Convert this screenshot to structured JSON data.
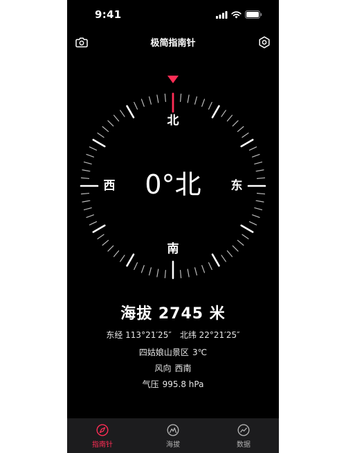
{
  "status_bar": {
    "time": "9:41"
  },
  "header": {
    "title": "极简指南针",
    "left_icon": "camera-icon",
    "right_icon": "settings-hexagon-icon"
  },
  "compass": {
    "heading_degrees": 0,
    "heading_text": "0°北",
    "directions": {
      "north": "北",
      "east": "东",
      "south": "南",
      "west": "西"
    },
    "needle_color": "#ff2d55"
  },
  "info": {
    "altitude_label": "海拔 2745 米",
    "longitude": "东经 113°21′25″",
    "latitude": "北纬 22°21′25″",
    "location": "四姑娘山景区",
    "temperature": "3℃",
    "wind_label": "风向",
    "wind_value": "西南",
    "pressure_label": "气压",
    "pressure_value": "995.8 hPa"
  },
  "tabs": [
    {
      "label": "指南针",
      "icon": "compass-icon",
      "active": true
    },
    {
      "label": "海拔",
      "icon": "altitude-icon",
      "active": false
    },
    {
      "label": "数据",
      "icon": "data-icon",
      "active": false
    }
  ],
  "colors": {
    "accent": "#ff2d55",
    "background": "#000000",
    "tab_bar": "#1c1c1e"
  }
}
